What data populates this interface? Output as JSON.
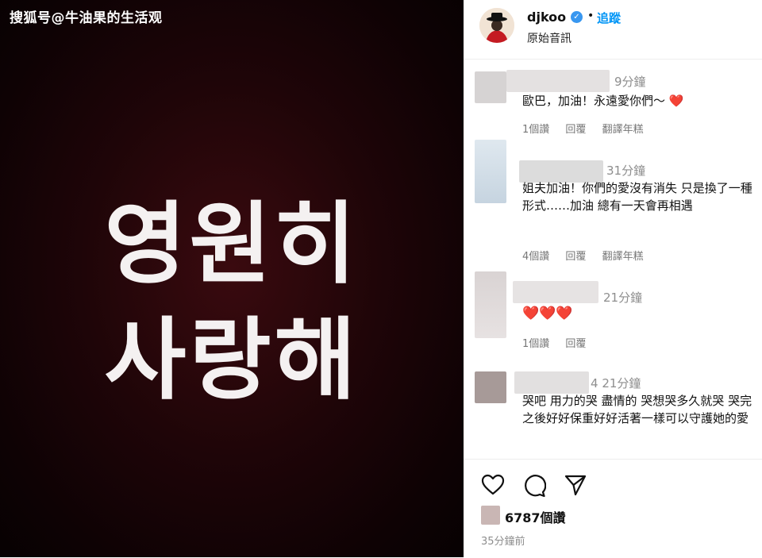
{
  "watermark": "搜狐号@牛油果的生活观",
  "image_text": {
    "line1": "영원히",
    "line2": "사랑해"
  },
  "header": {
    "username": "djkoo",
    "separator": "•",
    "follow": "追蹤",
    "audio": "原始音訊"
  },
  "comments": [
    {
      "time": "9分鐘",
      "text": "歐巴，加油！永遠愛你們～",
      "emoji": "❤️",
      "likes": "1個讚",
      "reply": "回覆",
      "translate": "翻譯年糕"
    },
    {
      "time": "31分鐘",
      "text": "姐夫加油！你們的愛沒有消失 只是換了一種形式……加油 總有一天會再相遇",
      "likes": "4個讚",
      "reply": "回覆",
      "translate": "翻譯年糕"
    },
    {
      "time": "21分鐘",
      "emoji": "❤️❤️❤️",
      "likes": "1個讚",
      "reply": "回覆"
    },
    {
      "time": "21分鐘",
      "name_suffix": "4",
      "text": "哭吧 用力的哭 盡情的 哭想哭多久就哭 哭完之後好好保重好好活著一樣可以守護她的愛"
    }
  ],
  "footer": {
    "likes": "6787個讚",
    "posted": "35分鐘前"
  },
  "icons": [
    "heart-icon",
    "comment-icon",
    "share-icon",
    "verified-icon"
  ],
  "colors": {
    "accent": "#0095f6",
    "heart": "#e0182d",
    "verified": "#3897f0"
  }
}
